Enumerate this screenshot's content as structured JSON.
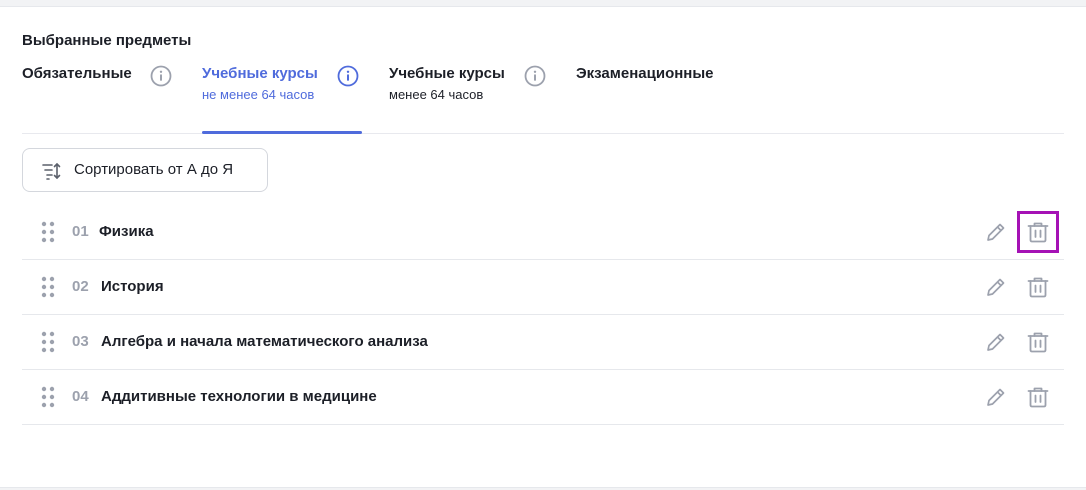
{
  "section_title": "Выбранные предметы",
  "tabs": [
    {
      "title": "Обязательные",
      "subtitle": "",
      "info_icon": "info-icon",
      "active": false
    },
    {
      "title": "Учебные курсы",
      "subtitle": "не менее 64 часов",
      "info_icon": "info-icon",
      "active": true
    },
    {
      "title": "Учебные курсы",
      "subtitle": "менее 64 часов",
      "info_icon": "info-icon",
      "active": false
    },
    {
      "title": "Экзаменационные",
      "subtitle": "",
      "active": false
    }
  ],
  "sort_button": {
    "label": "Сортировать от А до Я",
    "icon": "sort-icon"
  },
  "subjects": [
    {
      "num": "01",
      "name": "Физика"
    },
    {
      "num": "02",
      "name": "История"
    },
    {
      "num": "03",
      "name": "Алгебра и начала математического анализа"
    },
    {
      "num": "04",
      "name": "Аддитивные технологии в медицине"
    }
  ],
  "colors": {
    "accent": "#4f6bdc",
    "highlight_box": "#a512b5",
    "icon_gray": "#9ca1ad",
    "text": "#1c1f27"
  }
}
